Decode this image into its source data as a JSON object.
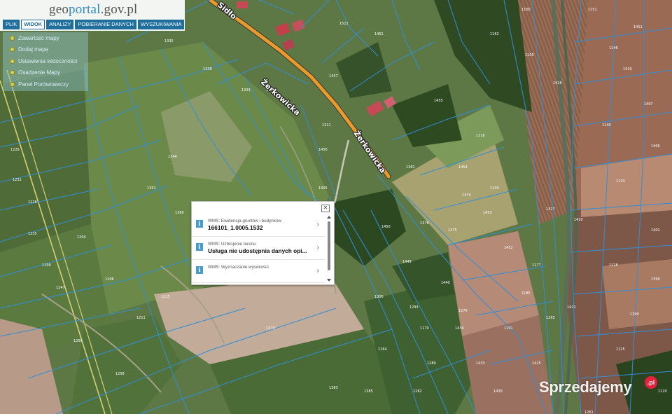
{
  "header": {
    "logo_text_part1": "geo",
    "logo_text_part2": "portal",
    "logo_text_part3": ".gov.pl",
    "menu": [
      "PLIK",
      "WIDOK",
      "ANALIZY",
      "POBIERANIE DANYCH",
      "WYSZUKIWANIA"
    ],
    "active_menu": "WIDOK"
  },
  "side_panel": {
    "items": [
      "Zawartość mapy",
      "Dodaj mapę",
      "Ustawienia widoczności",
      "Osadzenie Mapy",
      "Panel Porównawczy"
    ]
  },
  "map": {
    "streets": [
      "Żerkowicka",
      "Żerkowicka",
      "Sidło"
    ],
    "parcels": [
      "1521",
      "1461",
      "1457",
      "1456",
      "1455",
      "1454",
      "1453",
      "1452",
      "1450",
      "1449",
      "1440",
      "1434",
      "1433",
      "1430",
      "1425",
      "1421",
      "1420",
      "1417",
      "1416",
      "1411",
      "1410",
      "1407",
      "1406",
      "1402",
      "1399",
      "1390",
      "1385",
      "1383",
      "1381",
      "1376",
      "1375",
      "1374",
      "1373",
      "1370",
      "1365",
      "1360",
      "1351",
      "1344",
      "1338",
      "1335",
      "1333",
      "1321",
      "1316",
      "1311",
      "1305",
      "1300",
      "1293",
      "1289",
      "1282",
      "1270",
      "1265",
      "1261",
      "1258",
      "1250",
      "1247",
      "1235",
      "1231",
      "1228",
      "1226",
      "1215",
      "1211",
      "1206",
      "1204",
      "1199",
      "1191",
      "1185",
      "1177",
      "1170",
      "1164",
      "1162",
      "1160",
      "1151",
      "1146",
      "1140",
      "1133",
      "1128",
      "1125",
      "1120",
      "1116",
      "1109",
      "1105"
    ]
  },
  "popup": {
    "rows": [
      {
        "title": "WMS: Ewidencja gruntów i budynków",
        "value": "166101_1.0005.1532"
      },
      {
        "title": "WMS: Uzbrojenie terenu",
        "value": "Usługa nie udostępnia danych opi..."
      },
      {
        "title": "WMS: Wyznaczanie wysokości",
        "value": ""
      }
    ]
  },
  "watermark": {
    "text": "Sprzedajemy",
    "badge": ".pl"
  },
  "colors": {
    "parcel_line": "#2f8fd8",
    "road": "#e89a2a",
    "accent": "#1f6e9c"
  }
}
